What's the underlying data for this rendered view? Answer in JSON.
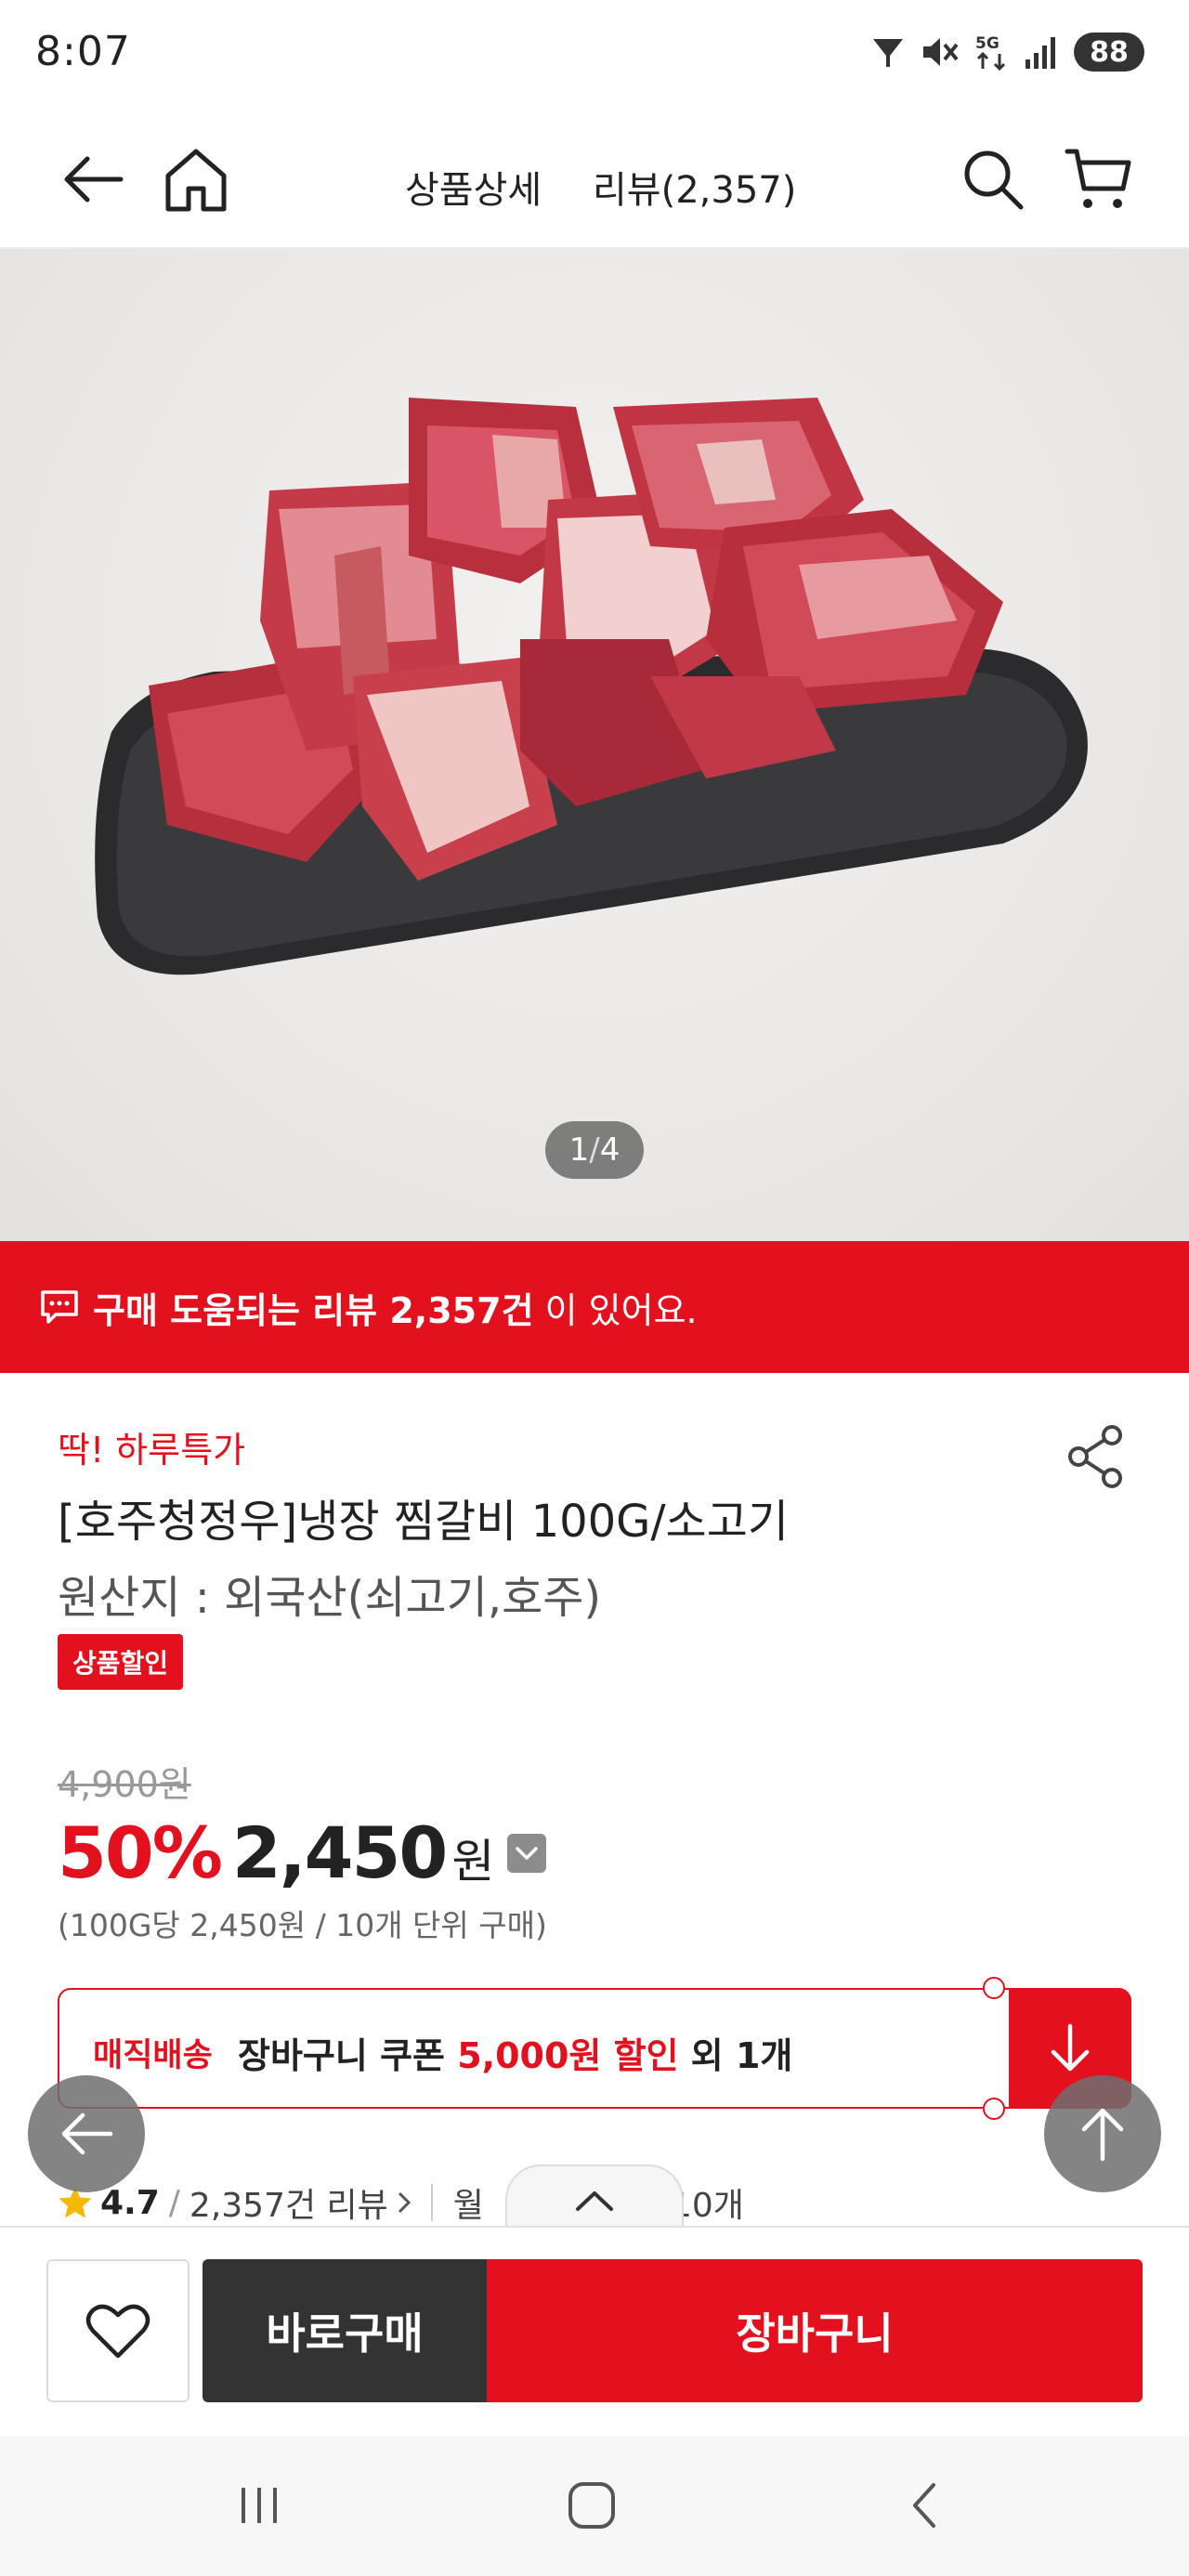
{
  "status_bar": {
    "time": "8:07",
    "battery": "88",
    "network": "5G",
    "icons": [
      "wifi-icon",
      "mute-icon",
      "5g-icon",
      "signal-icon",
      "battery-icon"
    ]
  },
  "nav": {
    "back_icon": "back-arrow-icon",
    "home_icon": "home-icon",
    "tab_detail": "상품상세",
    "tab_review": "리뷰(2,357)",
    "search_icon": "search-icon",
    "cart_icon": "cart-icon"
  },
  "gallery": {
    "counter_current": "1",
    "counter_sep": "/",
    "counter_total": "4"
  },
  "review_banner": {
    "icon": "chat-bubble-icon",
    "strong_text": "구매 도움되는 리뷰 2,357건",
    "rest_text": " 이 있어요."
  },
  "product": {
    "special_tag": "딱! 하루특가",
    "title": "[호주청정우]냉장 찜갈비 100G/소고기",
    "origin": "원산지 : 외국산(쇠고기,호주)",
    "discount_badge": "상품할인",
    "share_icon": "share-icon"
  },
  "price": {
    "original": "4,900원",
    "rate": "50%",
    "value": "2,450",
    "unit": "원",
    "note": "(100G당 2,450원 / 10개 단위 구매)"
  },
  "coupon": {
    "label": "매직배송",
    "text_prefix": "장바구니 쿠폰 ",
    "text_highlight": "5,000원 할인",
    "text_suffix": " 외 1개"
  },
  "rating": {
    "score": "4.7",
    "separator": "/",
    "count": "2,357건 리뷰",
    "monthly_prefix": "월",
    "monthly_count": "10개"
  },
  "actions": {
    "buy_now": "바로구매",
    "add_cart": "장바구니"
  },
  "colors": {
    "accent": "#e3111e",
    "dark": "#333333"
  }
}
